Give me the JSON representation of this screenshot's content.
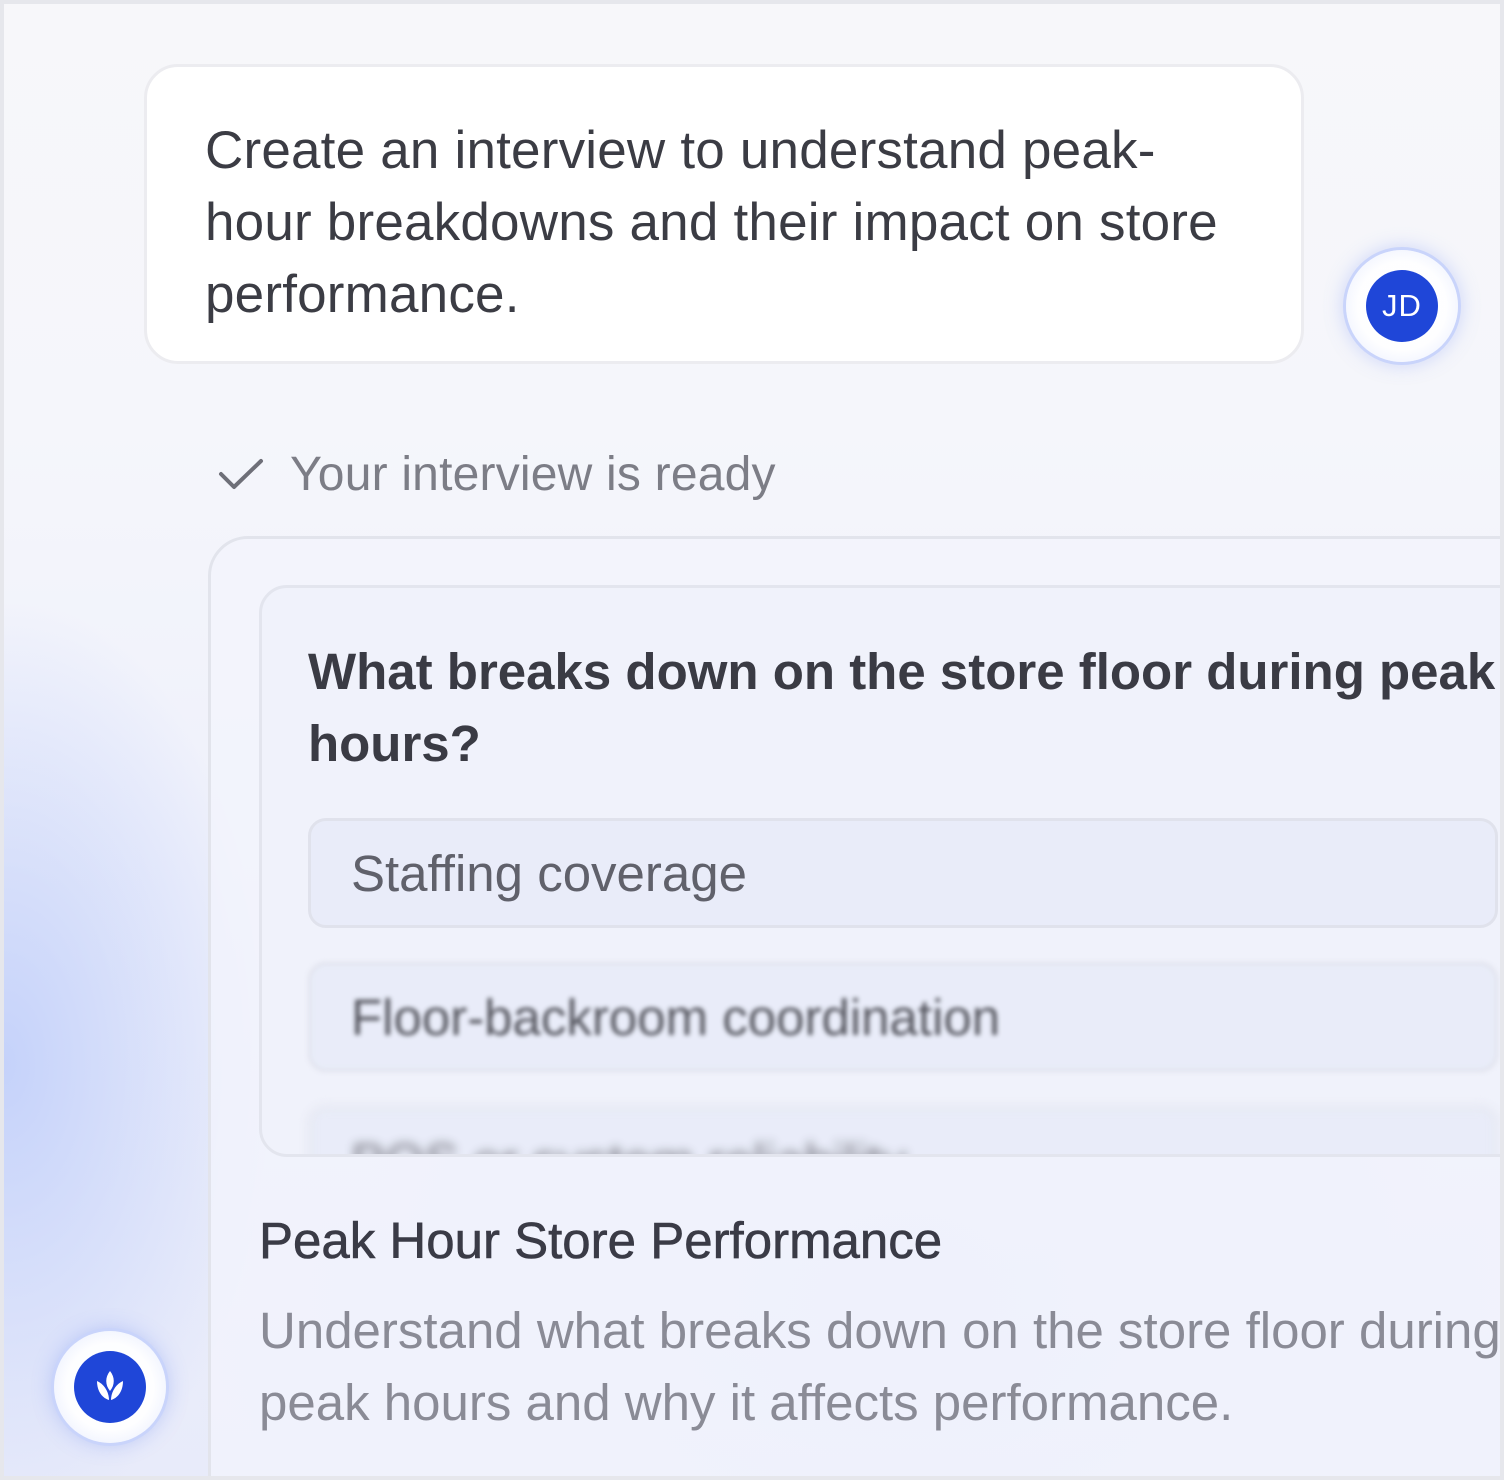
{
  "prompt": {
    "text": "Create an interview to understand peak-hour breakdowns and their impact on store performance."
  },
  "user_avatar": {
    "initials": "JD",
    "color": "#1f46d8"
  },
  "assistant_avatar": {
    "icon": "leaf-icon",
    "color": "#1f46d8"
  },
  "status": {
    "icon": "check-icon",
    "text": "Your interview is ready"
  },
  "interview": {
    "question": "What breaks down on the store floor during peak hours?",
    "options": [
      "Staffing coverage",
      "Floor-backroom coordination",
      "POS or system reliability"
    ],
    "title": "Peak Hour Store Performance",
    "description": "Understand what breaks down on the store floor during peak hours and why it affects performance."
  }
}
